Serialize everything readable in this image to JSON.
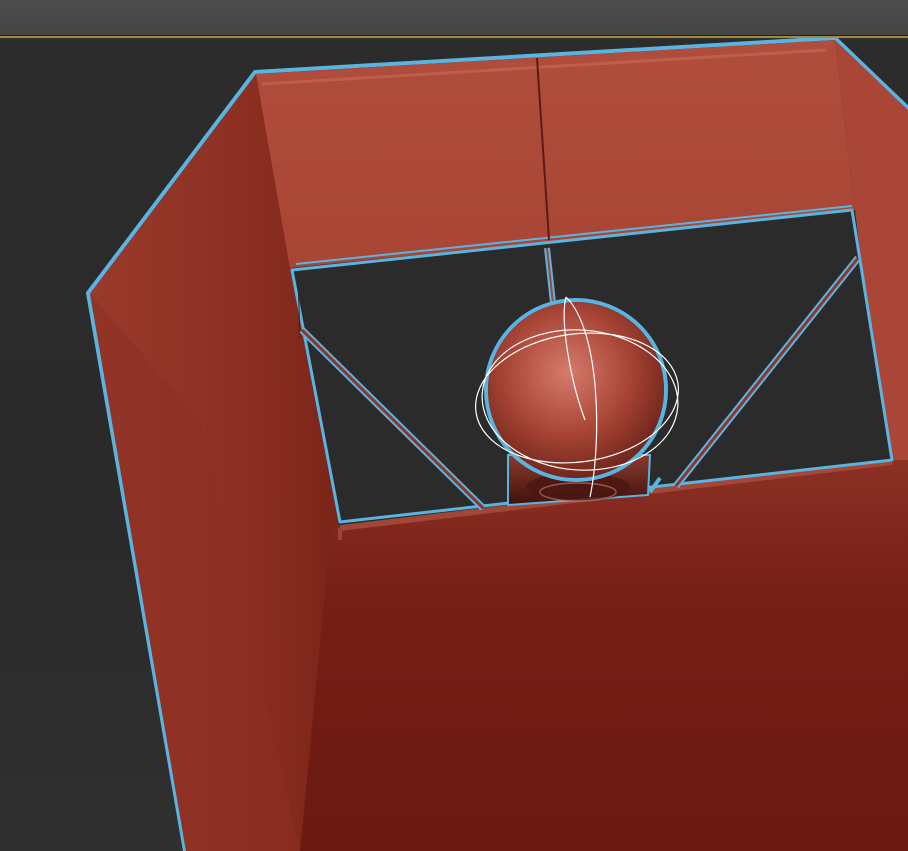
{
  "viewport": {
    "active_border_color": "#a58a3a",
    "background_color": "#2c2c2c",
    "selection_outline_color": "#5ab4e0",
    "object_color": "#a84535",
    "gizmo_color": "#ffffff",
    "active": true
  },
  "scene": {
    "objects": [
      {
        "name": "lamp-shade",
        "selected": true
      },
      {
        "name": "bulb-sphere",
        "selected": true
      },
      {
        "name": "bulb-socket",
        "selected": false
      }
    ],
    "gizmo": "rotate-gizmo-icon"
  }
}
